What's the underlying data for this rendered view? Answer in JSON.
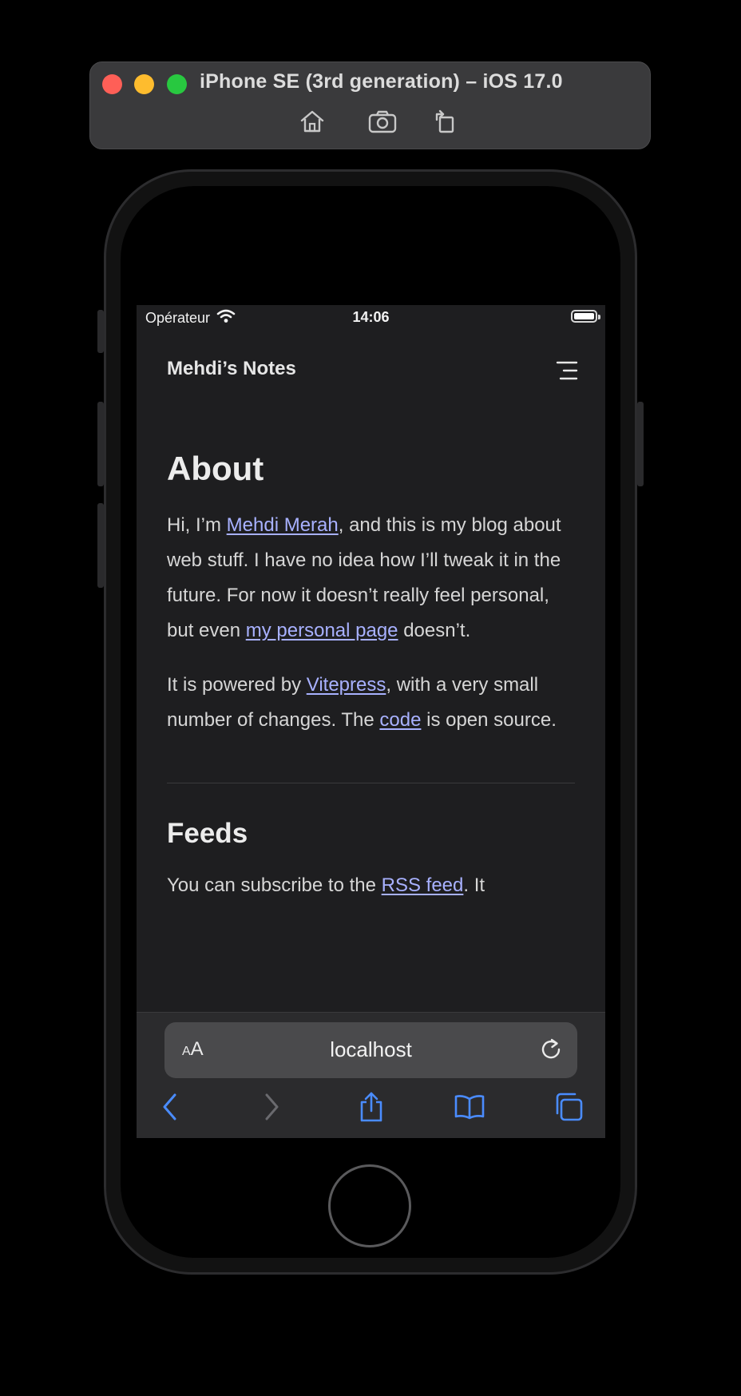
{
  "simulator": {
    "title": "iPhone SE (3rd generation) – iOS 17.0",
    "controls": [
      "home-icon",
      "screenshot-icon",
      "rotate-icon"
    ]
  },
  "status_bar": {
    "carrier": "Opérateur",
    "time": "14:06"
  },
  "site": {
    "title": "Mehdi’s Notes"
  },
  "about": {
    "heading": "About",
    "p1_before_link1": "Hi, I’m ",
    "link_author": "Mehdi Merah",
    "p1_after_link1": ", and this is my blog about web stuff. I have no idea how I’ll tweak it in the future. For now it doesn’t really feel personal, but even ",
    "link_personal_page": "my personal page",
    "p1_end": " doesn’t.",
    "p2_before_link": "It is powered by ",
    "link_vitepress": "Vitepress",
    "p2_middle": ", with a very small number of changes. The ",
    "link_code": "code",
    "p2_end": " is open source."
  },
  "feeds": {
    "heading": "Feeds",
    "p_before_link": "You can subscribe to the ",
    "link_rss": "RSS feed",
    "p_after_link": ". It"
  },
  "safari": {
    "aa_small": "A",
    "aa_large": "A",
    "url": "localhost",
    "toolbar": [
      "back-icon",
      "forward-icon",
      "share-icon",
      "bookmarks-icon",
      "tabs-icon"
    ]
  },
  "colors": {
    "link": "#a8b1ff",
    "toolbar_accent": "#4a8cff",
    "page_background": "#1e1e20"
  }
}
